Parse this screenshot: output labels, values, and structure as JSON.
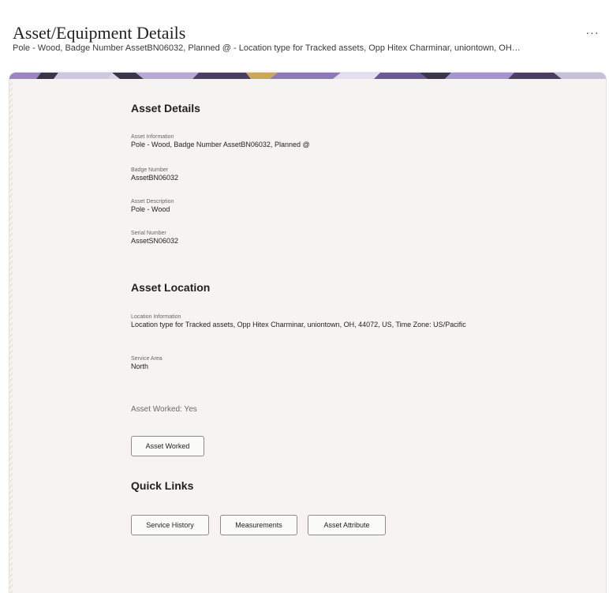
{
  "header": {
    "title": "Asset/Equipment Details",
    "subtitle": "Pole - Wood, Badge Number AssetBN06032, Planned @ - Location type for Tracked assets, Opp Hitex Charminar, uniontown, OH…",
    "more_label": "···"
  },
  "asset_details": {
    "title": "Asset Details",
    "fields": [
      {
        "label": "Asset Information",
        "value": "Pole - Wood, Badge Number AssetBN06032, Planned @"
      },
      {
        "label": "Badge Number",
        "value": "AssetBN06032"
      },
      {
        "label": "Asset Description",
        "value": "Pole - Wood"
      },
      {
        "label": "Serial Number",
        "value": "AssetSN06032"
      }
    ]
  },
  "asset_location": {
    "title": "Asset Location",
    "fields": [
      {
        "label": "Location Information",
        "value": "Location type for Tracked assets, Opp Hitex Charminar, uniontown, OH, 44072, US, Time Zone: US/Pacific"
      },
      {
        "label": "Service Area",
        "value": "North"
      }
    ]
  },
  "asset_worked": {
    "status": "Asset Worked: Yes",
    "button_label": "Asset Worked"
  },
  "quick_links": {
    "title": "Quick Links",
    "buttons": [
      {
        "label": "Service History"
      },
      {
        "label": "Measurements"
      },
      {
        "label": "Asset Attribute"
      }
    ]
  },
  "colors": {
    "panel_bg": "#f5f4f2",
    "banner_purple": "#9b86c2",
    "banner_dark": "#3a3548",
    "banner_gold": "#c9a85a"
  }
}
